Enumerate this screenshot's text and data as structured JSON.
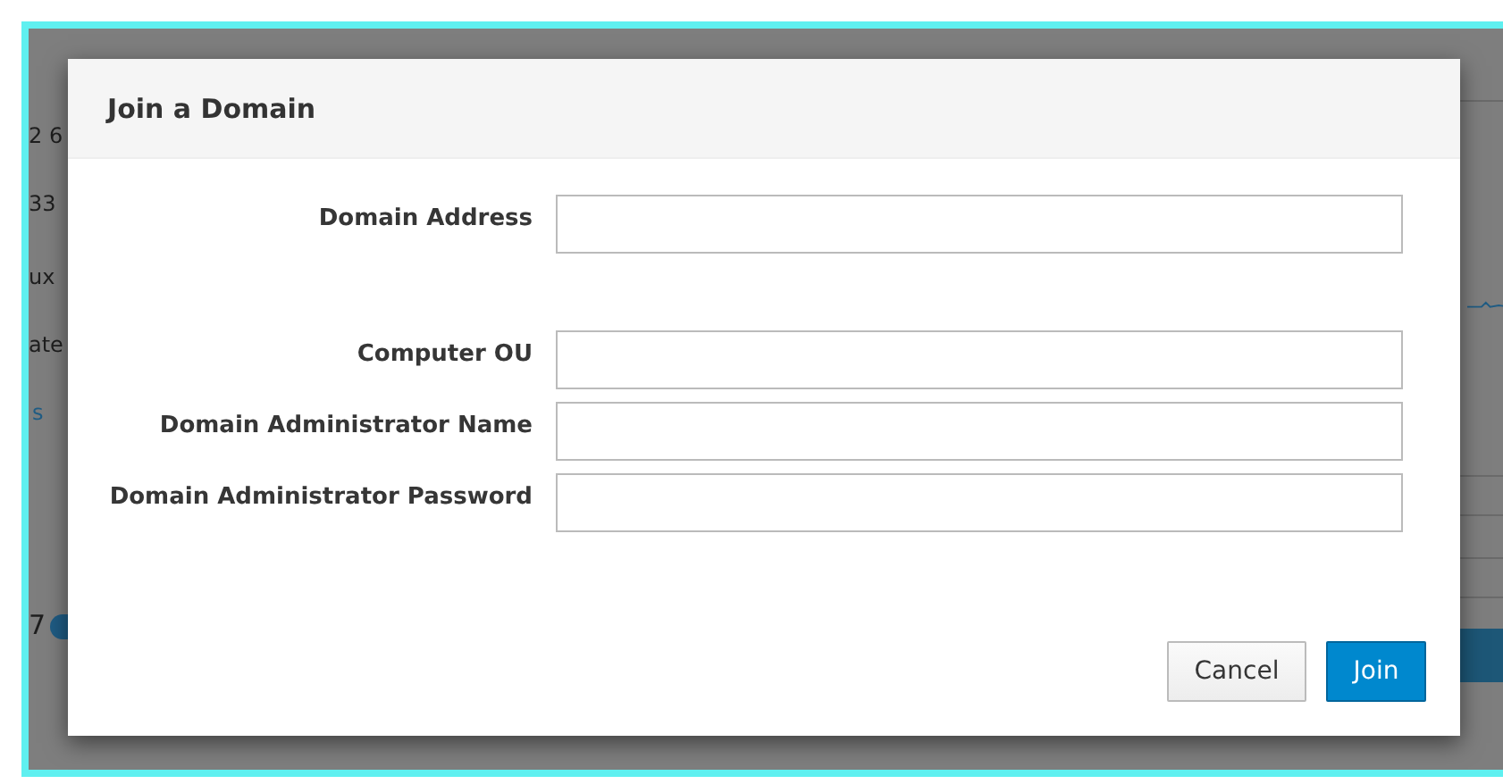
{
  "background": {
    "fragments": [
      {
        "text": "2 6",
        "kind": "text"
      },
      {
        "text": "33",
        "kind": "text"
      },
      {
        "text": "ux",
        "kind": "text"
      },
      {
        "text": "ate",
        "kind": "text"
      },
      {
        "text": "s",
        "kind": "link"
      },
      {
        "text": "7",
        "kind": "info"
      }
    ]
  },
  "dialog": {
    "title": "Join a Domain",
    "field_groups": [
      {
        "fields": [
          {
            "label": "Domain Address"
          }
        ]
      },
      {
        "fields": [
          {
            "label": "Computer OU"
          },
          {
            "label": "Domain Administrator Name"
          },
          {
            "label": "Domain Administrator Password"
          }
        ]
      }
    ],
    "buttons": [
      {
        "label": "Cancel",
        "kind": "default"
      },
      {
        "label": "Join",
        "kind": "primary"
      }
    ]
  }
}
